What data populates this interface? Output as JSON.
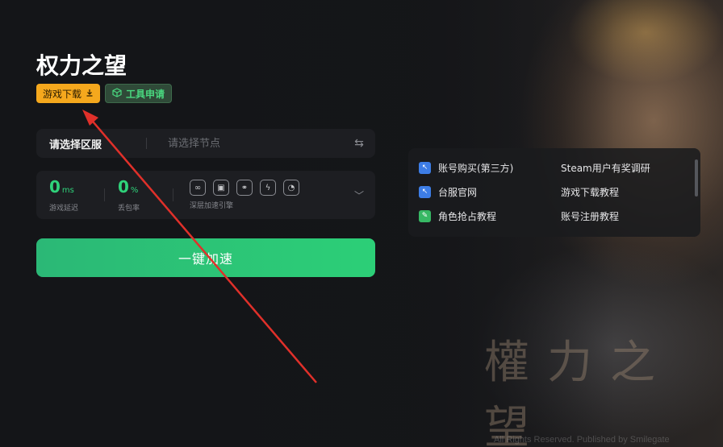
{
  "game": {
    "title": "权力之望",
    "download_tag": "游戏下载",
    "tool_tag": "工具申请"
  },
  "region": {
    "label": "请选择区服",
    "node_placeholder": "请选择节点"
  },
  "stats": {
    "latency_value": "0",
    "latency_unit": "ms",
    "latency_label": "游戏延迟",
    "loss_value": "0",
    "loss_unit": "%",
    "loss_label": "丢包率",
    "engine_label": "深层加速引擎"
  },
  "boost_button": "一键加速",
  "links": [
    {
      "label": "账号购买(第三方)",
      "icon": "blue-cursor-icon"
    },
    {
      "label": "Steam用户有奖调研",
      "icon": ""
    },
    {
      "label": "台服官网",
      "icon": "blue-cursor-icon"
    },
    {
      "label": "游戏下载教程",
      "icon": ""
    },
    {
      "label": "角色抢占教程",
      "icon": "green-pencil-icon"
    },
    {
      "label": "账号注册教程",
      "icon": ""
    }
  ],
  "background": {
    "watermark": "權力之望",
    "copyright": "All Rights Reserved. Published by Smilegate"
  },
  "colors": {
    "accent_green": "#2ccf77",
    "download_orange": "#f5a81d",
    "annotation_red": "#e0302a"
  }
}
